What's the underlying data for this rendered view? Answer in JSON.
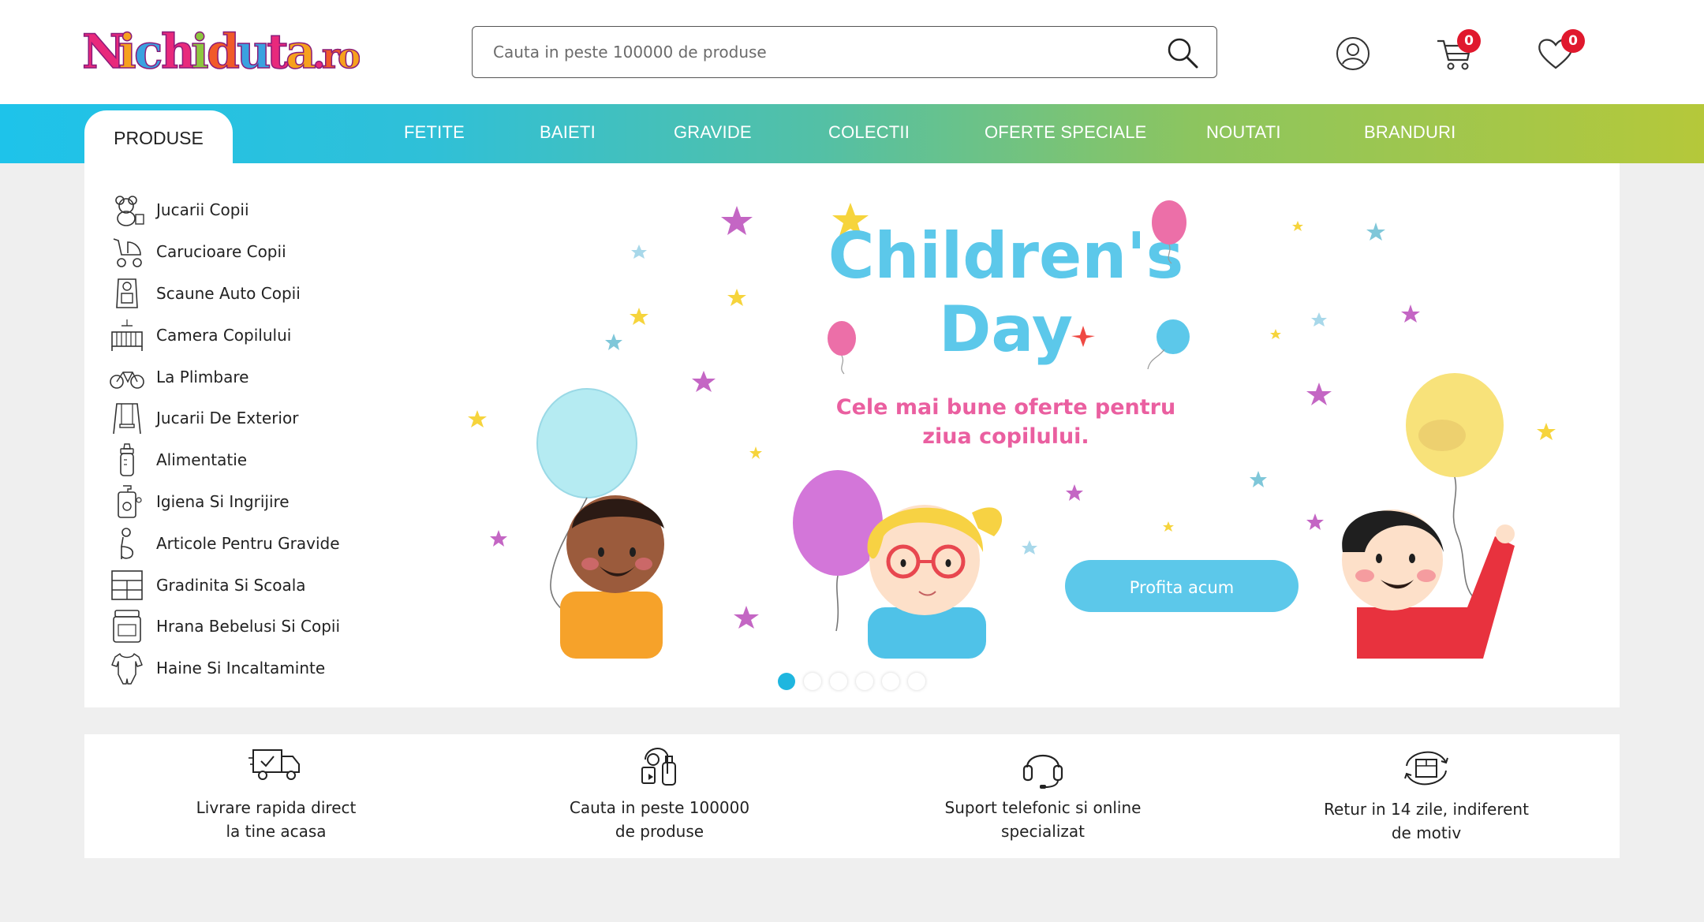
{
  "header": {
    "logo_text": "Nichiduta.ro",
    "search_placeholder": "Cauta in peste 100000 de produse",
    "cart_count": "0",
    "wishlist_count": "0"
  },
  "nav": {
    "produse": "PRODUSE",
    "items": [
      "FETITE",
      "BAIETI",
      "GRAVIDE",
      "COLECTII",
      "OFERTE SPECIALE",
      "NOUTATI",
      "BRANDURI"
    ]
  },
  "categories": [
    "Jucarii Copii",
    "Carucioare Copii",
    "Scaune Auto Copii",
    "Camera Copilului",
    "La Plimbare",
    "Jucarii De Exterior",
    "Alimentatie",
    "Igiena Si Ingrijire",
    "Articole Pentru Gravide",
    "Gradinita Si Scoala",
    "Hrana Bebelusi Si Copii",
    "Haine Si Incaltaminte"
  ],
  "banner": {
    "title_line1": "Children's",
    "title_line2": "Day",
    "subtitle_line1": "Cele mai bune oferte pentru",
    "subtitle_line2": "ziua copilului.",
    "cta": "Profita acum",
    "slide_count": 6,
    "active_slide": 1
  },
  "features": [
    {
      "line1": "Livrare rapida direct",
      "line2": "la tine acasa",
      "icon": "delivery-truck-icon"
    },
    {
      "line1": "Cauta in peste 100000",
      "line2": "de produse",
      "icon": "baby-products-icon"
    },
    {
      "line1": "Suport telefonic si online",
      "line2": "specializat",
      "icon": "headset-icon"
    },
    {
      "line1": "Retur in 14 zile, indiferent",
      "line2": "de motiv",
      "icon": "return-box-icon"
    }
  ],
  "colors": {
    "accent": "#1fb6df",
    "badge": "#e0182d",
    "banner_title": "#5cc8ea",
    "banner_subtitle": "#ea5fa0"
  }
}
